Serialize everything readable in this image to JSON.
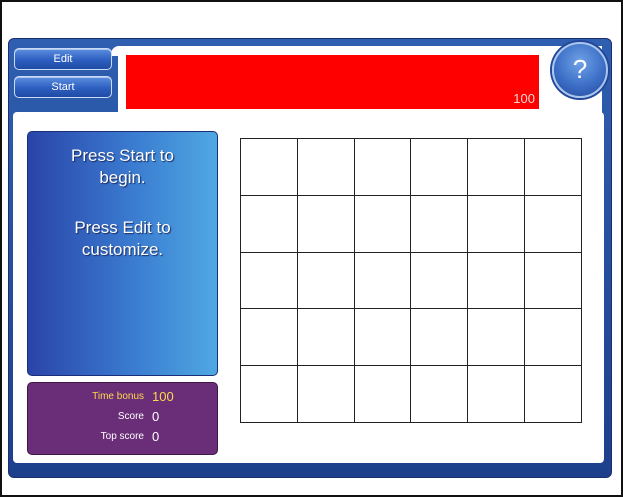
{
  "toolbar": {
    "edit_label": "Edit",
    "start_label": "Start",
    "help_label": "?"
  },
  "header": {
    "bar_value": "100",
    "bar_color": "#ff0000"
  },
  "message": {
    "line1": "Press Start to",
    "line2": "begin.",
    "line3": "Press Edit to",
    "line4": "customize."
  },
  "scores": {
    "time_bonus_label": "Time bonus",
    "time_bonus_value": "100",
    "score_label": "Score",
    "score_value": "0",
    "top_score_label": "Top score",
    "top_score_value": "0"
  },
  "grid": {
    "rows": 5,
    "columns": 6
  },
  "colors": {
    "frame": "#1d3f8c",
    "score_panel": "#6a2e78",
    "time_bonus_text": "#ffd84a"
  }
}
